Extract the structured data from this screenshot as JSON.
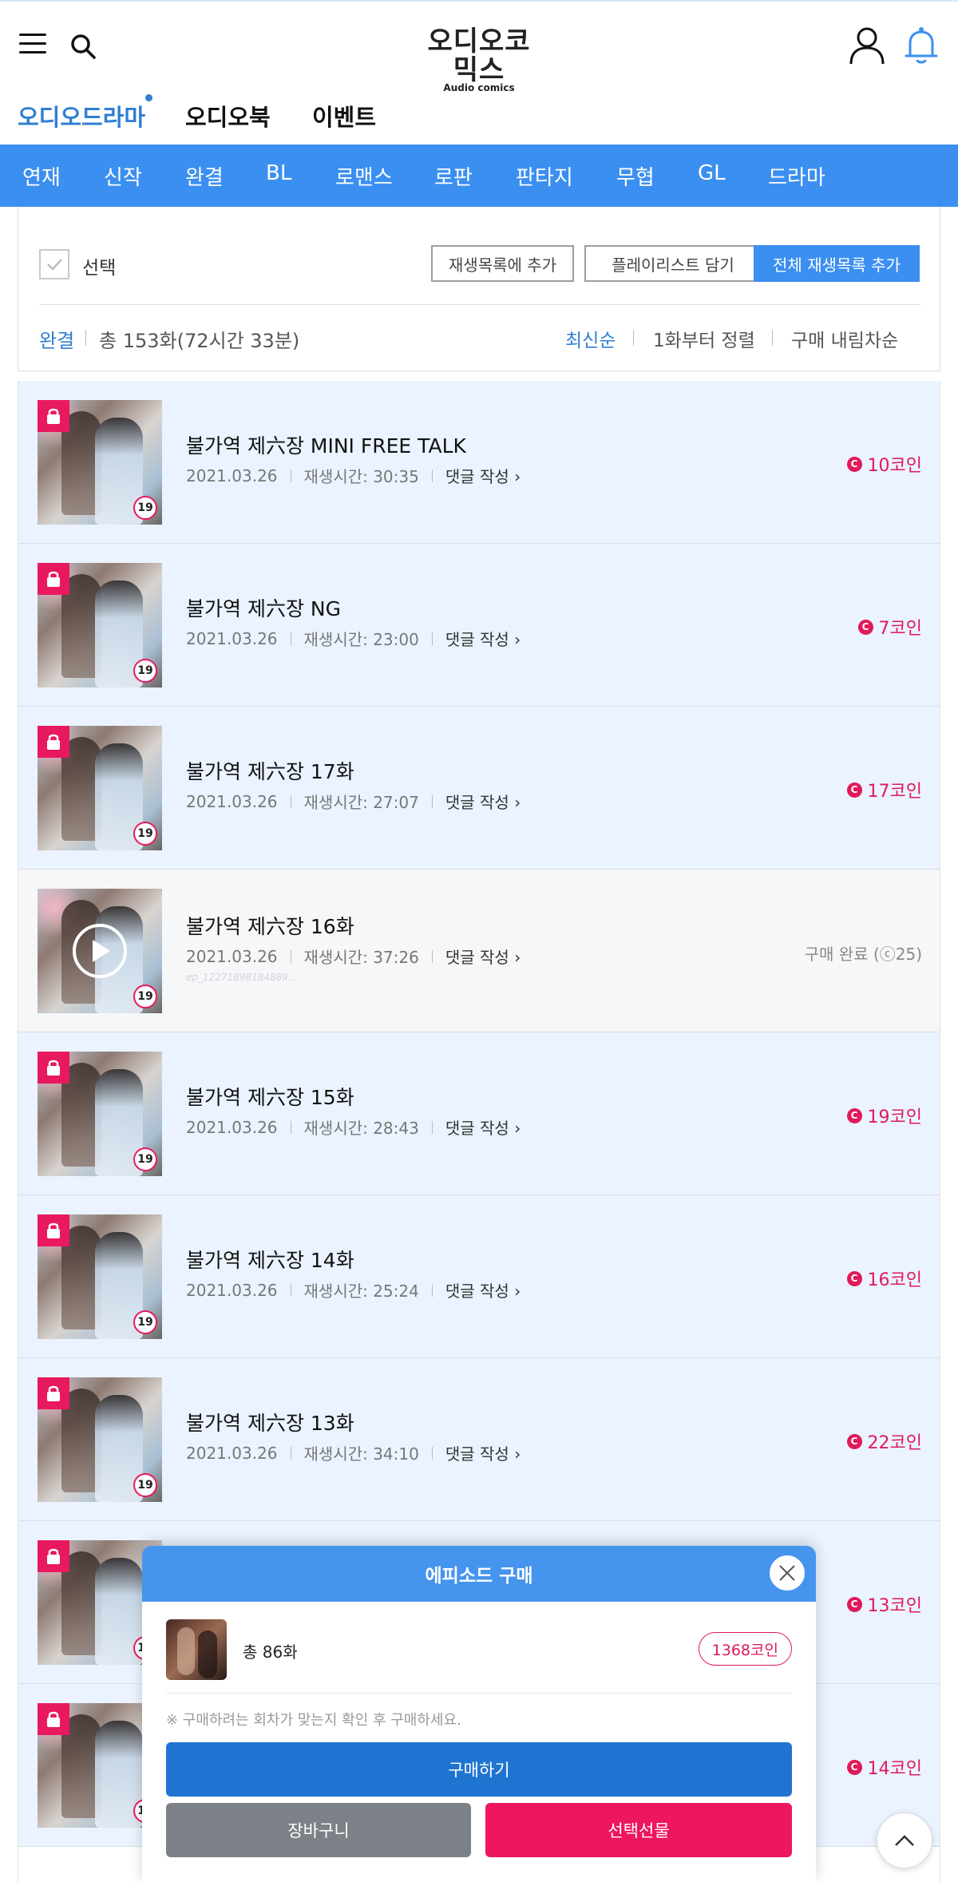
{
  "header": {
    "logo_main": "오디오코믹스",
    "logo_sub": "Audio comics"
  },
  "tabs": [
    {
      "label": "오디오드라마",
      "active": true
    },
    {
      "label": "오디오북",
      "active": false
    },
    {
      "label": "이벤트",
      "active": false
    }
  ],
  "genres": [
    "연재",
    "신작",
    "완결",
    "BL",
    "로맨스",
    "로판",
    "판타지",
    "무협",
    "GL",
    "드라마"
  ],
  "controls": {
    "select_label": "선택",
    "add_queue": "재생목록에 추가",
    "add_playlist": "플레이리스트 담기",
    "add_all": "전체 재생목록 추가",
    "status": "완결",
    "total": "총 153화(72시간 33분)",
    "sort_options": [
      "최신순",
      "1화부터 정렬",
      "구매 내림차순"
    ],
    "active_sort": "최신순"
  },
  "episodes": [
    {
      "title": "불가역 제六장 MINI FREE TALK",
      "date": "2021.03.26",
      "duration": "재생시간: 30:35",
      "comment": "댓글 작성",
      "price": "10코인",
      "locked": true
    },
    {
      "title": "불가역 제六장 NG",
      "date": "2021.03.26",
      "duration": "재생시간: 23:00",
      "comment": "댓글 작성",
      "price": "7코인",
      "locked": true
    },
    {
      "title": "불가역 제六장 17화",
      "date": "2021.03.26",
      "duration": "재생시간: 27:07",
      "comment": "댓글 작성",
      "price": "17코인",
      "locked": true
    },
    {
      "title": "불가역 제六장 16화",
      "date": "2021.03.26",
      "duration": "재생시간: 37:26",
      "comment": "댓글 작성",
      "price": "구매 완료 (ⓒ25)",
      "locked": false,
      "id_text": "ep_12271898184889..."
    },
    {
      "title": "불가역 제六장 15화",
      "date": "2021.03.26",
      "duration": "재생시간: 28:43",
      "comment": "댓글 작성",
      "price": "19코인",
      "locked": true
    },
    {
      "title": "불가역 제六장 14화",
      "date": "2021.03.26",
      "duration": "재생시간: 25:24",
      "comment": "댓글 작성",
      "price": "16코인",
      "locked": true
    },
    {
      "title": "불가역 제六장 13화",
      "date": "2021.03.26",
      "duration": "재생시간: 34:10",
      "comment": "댓글 작성",
      "price": "22코인",
      "locked": true
    },
    {
      "title": "",
      "date": "",
      "duration": "",
      "comment": "",
      "price": "13코인",
      "locked": true
    },
    {
      "title": "",
      "date": "",
      "duration": "",
      "comment": "",
      "price": "14코인",
      "locked": true
    }
  ],
  "badges": {
    "age": "19",
    "coin_symbol": "C"
  },
  "modal": {
    "title": "에피소드 구매",
    "count": "총 86화",
    "coins": "1368코인",
    "note": "※ 구매하려는 회차가 맞는지 확인 후 구매하세요.",
    "buy": "구매하기",
    "cart": "장바구니",
    "gift": "선택선물"
  },
  "colors": {
    "accent": "#3b8ff0",
    "price": "#e0195a",
    "locked_row": "#eaf3ff"
  }
}
